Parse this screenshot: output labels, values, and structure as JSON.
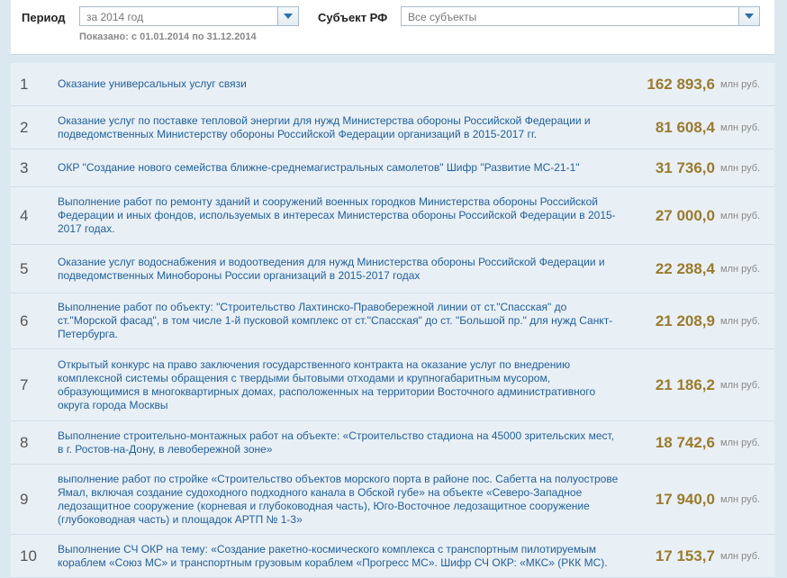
{
  "filters": {
    "period_label": "Период",
    "period_value": "за 2014 год",
    "region_label": "Субъект РФ",
    "region_value": "Все субъекты",
    "shown_range": "Показано: с 01.01.2014 по 31.12.2014"
  },
  "unit": "млн руб.",
  "rows": [
    {
      "rank": "1",
      "title": "Оказание универсальных услуг связи",
      "amount": "162 893,6"
    },
    {
      "rank": "2",
      "title": "Оказание услуг по поставке тепловой энергии для нужд Министерства обороны Российской Федерации и подведомственных Министерству обороны Российской Федерации организаций в 2015-2017 гг.",
      "amount": "81 608,4"
    },
    {
      "rank": "3",
      "title": "ОКР \"Создание нового семейства ближне-среднемагистральных самолетов\" Шифр \"Развитие МС-21-1\"",
      "amount": "31 736,0"
    },
    {
      "rank": "4",
      "title": "Выполнение работ по ремонту зданий и сооружений военных городков Министерства обороны Российской Федерации и иных фондов, используемых в интересах Министерства обороны Российской Федерации в 2015-2017 годах.",
      "amount": "27 000,0"
    },
    {
      "rank": "5",
      "title": "Оказание услуг водоснабжения и водоотведения для нужд Министерства обороны Российской Федерации и подведомственных Минобороны России организаций в 2015-2017 годах",
      "amount": "22 288,4"
    },
    {
      "rank": "6",
      "title": "Выполнение работ по объекту: \"Строительство Лахтинско-Правобережной линии от ст.\"Спасская\" до ст.\"Морской фасад\", в том числе 1-й пусковой комплекс от ст.\"Спасская\" до ст. \"Большой пр.\" для нужд Санкт-Петербурга.",
      "amount": "21 208,9"
    },
    {
      "rank": "7",
      "title": "Открытый конкурс на право заключения государственного контракта на оказание услуг по внедрению комплексной системы обращения с твердыми бытовыми отходами и крупногабаритным мусором, образующимися в многоквартирных домах, расположенных на территории Восточного административного округа города Москвы",
      "amount": "21 186,2"
    },
    {
      "rank": "8",
      "title": "Выполнение строительно-монтажных работ на объекте: «Строительство стадиона на 45000 зрительских мест, в г. Ростов-на-Дону, в левобережной зоне»",
      "amount": "18 742,6"
    },
    {
      "rank": "9",
      "title": "выполнение работ по стройке «Строительство объектов морского порта в районе пос. Сабетта на полуострове Ямал, включая создание судоходного подходного канала в Обской губе» на объекте «Северо-Западное ледозащитное сооружение (корневая и глубоководная часть), Юго-Восточное ледозащитное сооружение (глубоководная часть) и площадок АРТП № 1-3»",
      "amount": "17 940,0"
    },
    {
      "rank": "10",
      "title": "Выполнение СЧ ОКР на тему: «Создание ракетно-космического комплекса с транспортным пилотируемым кораблем «Союз МС» и транспортным грузовым кораблем «Прогресс МС». Шифр СЧ ОКР: «МКС» (РКК МС).",
      "amount": "17 153,7"
    }
  ]
}
